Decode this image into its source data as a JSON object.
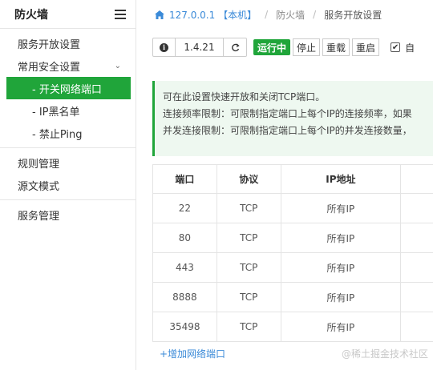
{
  "sidebar": {
    "title": "防火墙",
    "items": [
      {
        "label": "服务开放设置"
      },
      {
        "label": "常用安全设置"
      },
      {
        "label": "- 开关网络端口"
      },
      {
        "label": "- IP黑名单"
      },
      {
        "label": "- 禁止Ping"
      },
      {
        "label": "规则管理"
      },
      {
        "label": "源文模式"
      },
      {
        "label": "服务管理"
      }
    ]
  },
  "breadcrumb": {
    "home": "127.0.0.1 【本机】",
    "section": "防火墙",
    "current": "服务开放设置"
  },
  "toolbar": {
    "version": "1.4.21",
    "status": "运行中",
    "stop": "停止",
    "reload": "重载",
    "restart": "重启",
    "checkbox_label": "自"
  },
  "notice": {
    "line1": "可在此设置快速开放和关闭TCP端口。",
    "line2": "连接频率限制：可限制指定端口上每个IP的连接频率，如果",
    "line3": "并发连接限制：可限制指定端口上每个IP的并发连接数量，"
  },
  "table": {
    "headers": [
      "端口",
      "协议",
      "IP地址",
      ""
    ],
    "rows": [
      [
        "22",
        "TCP",
        "所有IP",
        ""
      ],
      [
        "80",
        "TCP",
        "所有IP",
        ""
      ],
      [
        "443",
        "TCP",
        "所有IP",
        ""
      ],
      [
        "8888",
        "TCP",
        "所有IP",
        ""
      ],
      [
        "35498",
        "TCP",
        "所有IP",
        ""
      ]
    ]
  },
  "add_link": "+增加网络端口",
  "watermark": "@稀土掘金技术社区",
  "colors": {
    "accent": "#20a53a",
    "link": "#3a8ad8"
  }
}
